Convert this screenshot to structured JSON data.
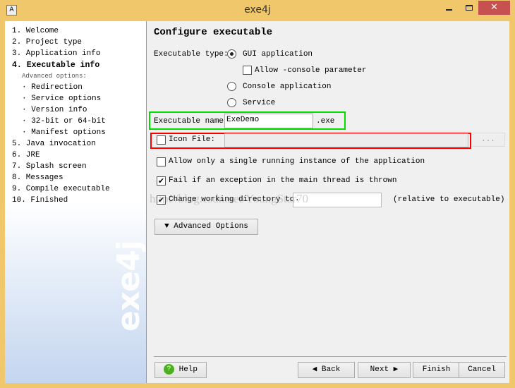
{
  "window": {
    "title": "exe4j",
    "app_icon": "A",
    "close_icon": "✕"
  },
  "sidebar": {
    "steps": [
      "1. Welcome",
      "2. Project type",
      "3. Application info",
      "4. Executable info"
    ],
    "advanced_label": "Advanced options:",
    "sub_items": [
      "· Redirection",
      "· Service options",
      "· Version info",
      "· 32-bit or 64-bit",
      "· Manifest options"
    ],
    "steps_after": [
      "5. Java invocation",
      "6. JRE",
      "7. Splash screen",
      "8. Messages",
      "9. Compile executable",
      "10. Finished"
    ],
    "active_step": "4. Executable info",
    "logo": "exe4j"
  },
  "main": {
    "heading": "Configure executable",
    "exe_type_label": "Executable type:",
    "types": [
      "GUI application",
      "Console application",
      "Service"
    ],
    "selected_type": "GUI application",
    "allow_console": {
      "label": "Allow -console parameter",
      "checked": false
    },
    "exe_name_label": "Executable name:",
    "exe_name_value": "ExeDemo",
    "exe_suffix": ".exe",
    "icon_file": {
      "label": "Icon File:",
      "checked": false,
      "value": "",
      "browse": "..."
    },
    "single_instance": {
      "label": "Allow only a single running instance of the application",
      "checked": false
    },
    "fail_exception": {
      "label": "Fail if an exception in the main thread is thrown",
      "checked": true
    },
    "change_dir": {
      "label": "Change working directory to:",
      "checked": true,
      "value": ".",
      "note": "(relative to executable)"
    },
    "advanced_button": "Advanced Options",
    "watermark": "http://blog.csdn.net/YoungStar70"
  },
  "footer": {
    "help": "Help",
    "back": "Back",
    "next": "Next",
    "finish": "Finish",
    "cancel": "Cancel"
  },
  "colors": {
    "frame": "#f0c86b",
    "close": "#c75050",
    "green_highlight": "#00e000",
    "red_highlight": "#ff0000"
  }
}
